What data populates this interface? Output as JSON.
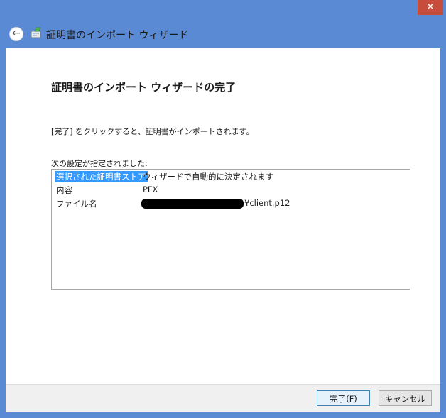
{
  "window": {
    "title": "証明書のインポート ウィザード",
    "close_glyph": "✕",
    "back_glyph": "←"
  },
  "content": {
    "heading": "証明書のインポート ウィザードの完了",
    "instruction": "[完了] をクリックすると、証明書がインポートされます。",
    "settings_label": "次の設定が指定されました:",
    "settings": [
      {
        "key": "選択された証明書ストア",
        "value": "ウィザードで自動的に決定されます"
      },
      {
        "key": "内容",
        "value": "PFX"
      },
      {
        "key": "ファイル名",
        "value": "¥client.p12"
      }
    ]
  },
  "buttons": {
    "finish": "完了(F)",
    "cancel": "キャンセル"
  },
  "colors": {
    "frame": "#5b8ad4",
    "close": "#c74c3c",
    "selection": "#3399ff"
  }
}
